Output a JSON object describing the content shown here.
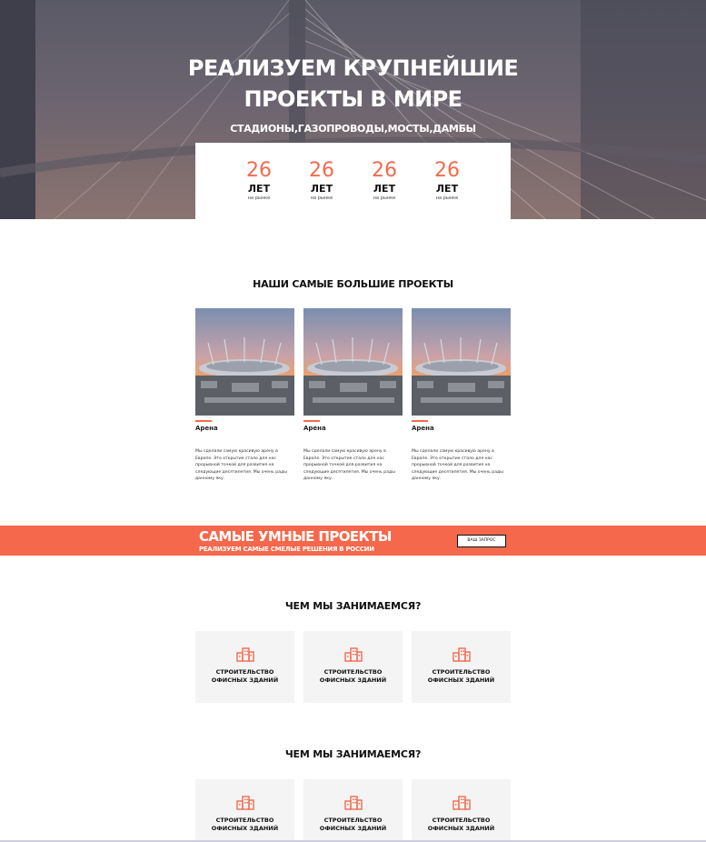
{
  "hero": {
    "title": "РЕАЛИЗУЕМ КРУПНЕЙШИЕ ПРОЕКТЫ В МИРЕ",
    "subtitle": "СТАДИОНЫ,ГАЗОПРОВОДЫ,МОСТЫ,ДАМБЫ",
    "stats": [
      {
        "number": "26",
        "unit": "ЛЕТ",
        "note": "на рынке"
      },
      {
        "number": "26",
        "unit": "ЛЕТ",
        "note": "на рынке"
      },
      {
        "number": "26",
        "unit": "ЛЕТ",
        "note": "на рынке"
      },
      {
        "number": "26",
        "unit": "ЛЕТ",
        "note": "на рынке"
      }
    ]
  },
  "projects": {
    "title": "НАШИ САМЫЕ БОЛЬШИЕ ПРОЕКТЫ",
    "items": [
      {
        "name": "Арена",
        "description": "Мы сделали самую красивую арену в Европе. Это открытие стало для нас прорывной точкой для развития на следующие десятилетия. Мы очень рады данному яку."
      },
      {
        "name": "Арена",
        "description": "Мы сделали самую красивую арену в Европе. Это открытие стало для нас прорывной точкой для развития на следующие десятилетия. Мы очень рады данному яку."
      },
      {
        "name": "Арена",
        "description": "Мы сделали самую красивую арену в Европе. Это открытие стало для нас прорывной точкой для развития на следующие десятилетия. Мы очень рады данному яку."
      }
    ]
  },
  "banner": {
    "title": "САМЫЕ УМНЫЕ ПРОЕКТЫ",
    "subtitle": "РЕАЛИЗУЕМ САМЫЕ СМЕЛЫЕ РЕШЕНИЯ В РОССИИ",
    "button": "ВАШ ЗАПРОС"
  },
  "services_1": {
    "title": "ЧЕМ МЫ ЗАНИМАЕМСЯ?",
    "items": [
      {
        "line1": "СТРОИТЕЛЬСТВО",
        "line2": "ОФИСНЫХ ЗДАНИЙ",
        "icon": "buildings-icon"
      },
      {
        "line1": "СТРОИТЕЛЬСТВО",
        "line2": "ОФИСНЫХ ЗДАНИЙ",
        "icon": "buildings-icon"
      },
      {
        "line1": "СТРОИТЕЛЬСТВО",
        "line2": "ОФИСНЫХ ЗДАНИЙ",
        "icon": "buildings-icon"
      }
    ]
  },
  "services_2": {
    "title": "ЧЕМ МЫ ЗАНИМАЕМСЯ?",
    "items": [
      {
        "line1": "СТРОИТЕЛЬСТВО",
        "line2": "ОФИСНЫХ ЗДАНИЙ",
        "icon": "buildings-icon"
      },
      {
        "line1": "СТРОИТЕЛЬСТВО",
        "line2": "ОФИСНЫХ ЗДАНИЙ",
        "icon": "buildings-icon"
      },
      {
        "line1": "СТРОИТЕЛЬСТВО",
        "line2": "ОФИСНЫХ ЗДАНИЙ",
        "icon": "buildings-icon"
      }
    ]
  },
  "colors": {
    "accent": "#f26b4e",
    "banner": "#f5684b",
    "card_bg": "#f4f4f4"
  }
}
